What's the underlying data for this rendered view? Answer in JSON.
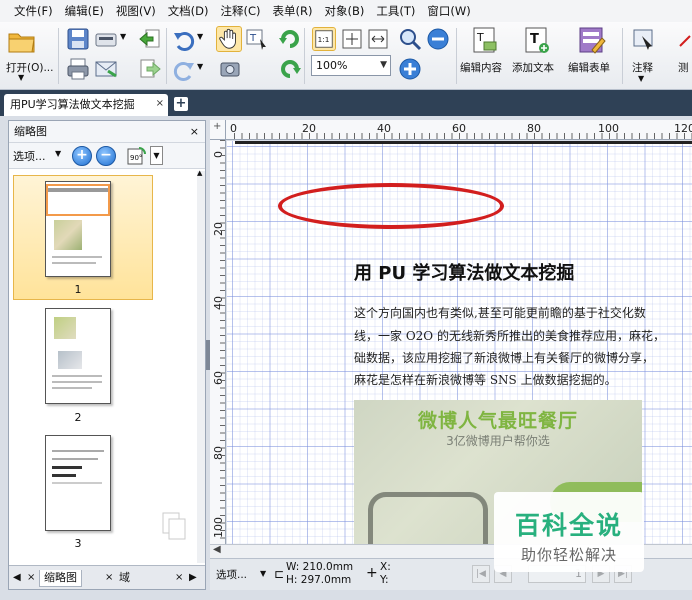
{
  "menu": [
    "文件(F)",
    "编辑(E)",
    "视图(V)",
    "文档(D)",
    "注释(C)",
    "表单(R)",
    "对象(B)",
    "工具(T)",
    "窗口(W)"
  ],
  "toolbar": {
    "open_label": "打开(O)...",
    "zoom_value": "100%",
    "edit_content_label": "编辑内容",
    "add_text_label": "添加文本",
    "edit_form_label": "编辑表单",
    "annotate_label": "注释",
    "measure_label": "测"
  },
  "tab": {
    "title": "用PU学习算法做文本挖掘",
    "close": "×",
    "new": "+"
  },
  "left_panel": {
    "title": "缩略图",
    "close": "×",
    "options_label": "选项...",
    "thumbnails": [
      {
        "page": "1",
        "selected": true
      },
      {
        "page": "2",
        "selected": false
      },
      {
        "page": "3",
        "selected": false
      }
    ],
    "bottom_tabs": [
      "缩略图",
      "域"
    ]
  },
  "rulers": {
    "top": [
      "0",
      "20",
      "40",
      "60",
      "80",
      "100",
      "120"
    ],
    "left": [
      "0",
      "20",
      "40",
      "60",
      "80",
      "100"
    ]
  },
  "document": {
    "title": "用 PU 学习算法做文本挖掘",
    "paragraph_lines": [
      "这个方向国内也有类似,甚至可能更前瞻的基于社交化数",
      "线，一家 O2O 的无线新秀所推出的美食推荐应用，麻花，",
      "础数据，该应用挖掘了新浪微博上有关餐厅的微博分享，",
      "麻花是怎样在新浪微博等 SNS 上做数据挖掘的。"
    ],
    "image": {
      "headline": "微博人气最旺餐厅",
      "subline": "3亿微博用户帮你选"
    }
  },
  "watermark": {
    "title": "百科全说",
    "subtitle": "助你轻松解决"
  },
  "statusbar": {
    "options_label": "选项...",
    "width_label": "W: 210.0mm",
    "height_label": "H: 297.0mm",
    "x_label": "X:",
    "y_label": "Y:",
    "page_field": "1"
  },
  "colors": {
    "annotation_ellipse": "#d21e1e",
    "tab_bar": "#2f4156",
    "watermark_green": "#28b07e",
    "photo_headline_green": "#7fb541"
  }
}
